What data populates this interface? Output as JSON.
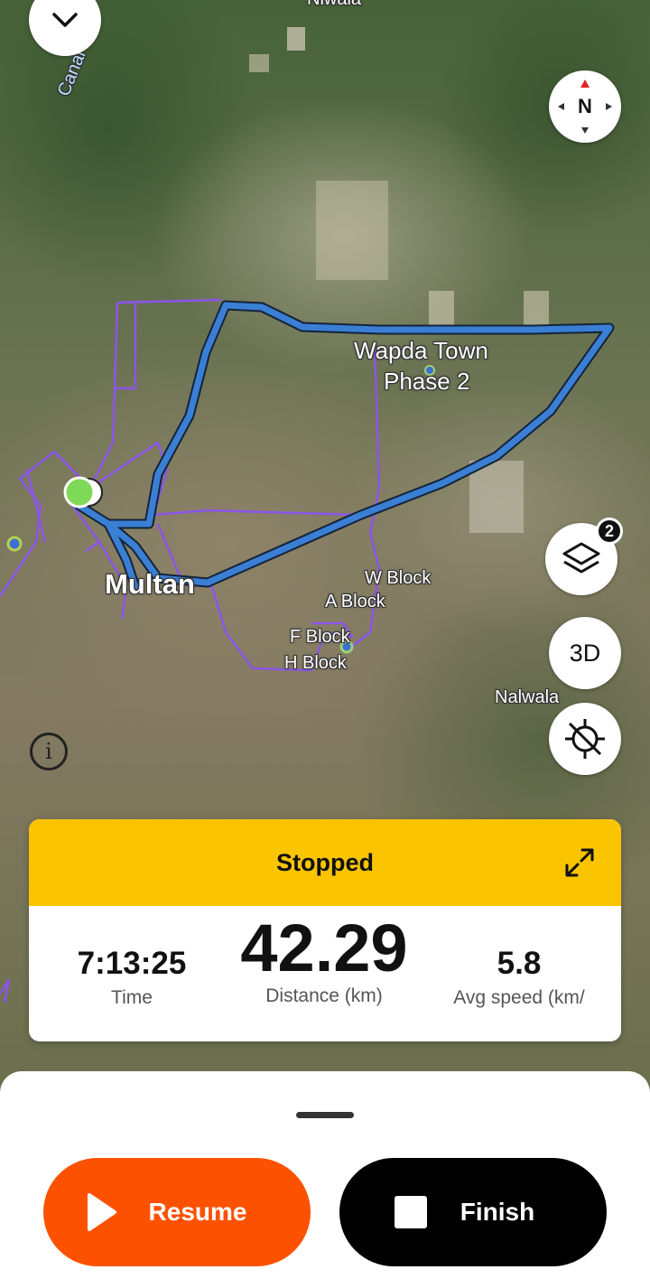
{
  "map": {
    "labels": {
      "top_place": "Niwala",
      "canal": "Canal",
      "wapda_line1": "Wapda Town",
      "wapda_line2": "Phase 2",
      "multan": "Multan",
      "w_block": "W Block",
      "a_block": "A Block",
      "f_block": "F Block",
      "h_block": "H Block",
      "nalwala": "Nalwala"
    },
    "compass_label": "N",
    "layers_badge": "2",
    "view_3d_label": "3D",
    "route_color": "#3a7fd4",
    "heatmap_color": "#8b55e8"
  },
  "controls": {
    "collapse_icon": "chevron-down-icon",
    "layers_icon": "layers-icon",
    "locate_icon": "location-off-icon",
    "info_icon": "info-icon"
  },
  "stats_card": {
    "status": "Stopped",
    "header_color": "#fbc400",
    "time_value": "7:13:25",
    "time_label": "Time",
    "distance_value": "42.29",
    "distance_label": "Distance (km)",
    "speed_value": "5.8",
    "speed_label": "Avg speed (km/"
  },
  "actions": {
    "resume_label": "Resume",
    "resume_color": "#fc5200",
    "finish_label": "Finish"
  }
}
